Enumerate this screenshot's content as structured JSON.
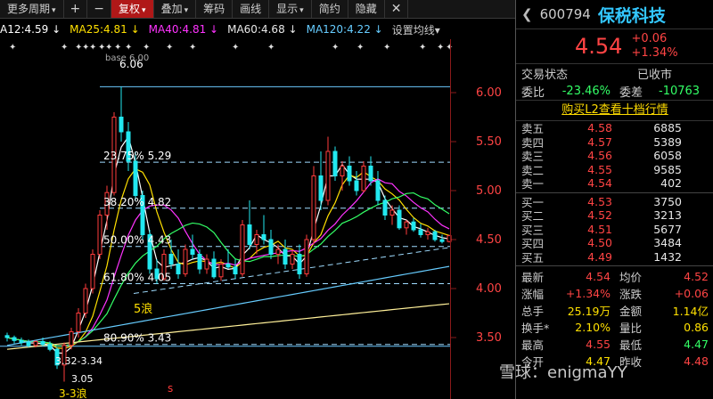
{
  "toolbar": {
    "period": "更多周期",
    "plus": "+",
    "minus": "−",
    "items": [
      "复权",
      "叠加",
      "筹码",
      "画线",
      "显示",
      "简约",
      "隐藏"
    ]
  },
  "ma": {
    "ma12": "A12:4.59",
    "ma25": "MA25:4.81",
    "ma40": "MA40:4.81",
    "ma60": "MA60:4.68",
    "ma120": "MA120:4.22",
    "settings": "设置均线"
  },
  "colors": {
    "up": "#ff3b3b",
    "down": "#22e8f0",
    "ma12": "#ffffff",
    "ma25": "#ffe000",
    "ma40": "#ff33ff",
    "ma60": "#33ff66",
    "ma120": "#66ccff",
    "ma250": "#fff099"
  },
  "chart": {
    "price_labels": [
      "6.00",
      "5.50",
      "5.00",
      "4.50",
      "4.00",
      "3.50"
    ],
    "top_label": "6.06",
    "top_partial": "base 6.00",
    "fib": [
      {
        "label": "23.75% 5.29",
        "price": 5.29
      },
      {
        "label": "38.20% 4.82",
        "price": 4.82
      },
      {
        "label": "50.00% 4.43",
        "price": 4.43
      },
      {
        "label": "61.80% 4.05",
        "price": 4.05
      },
      {
        "label": "80.90% 3.43",
        "price": 3.43
      }
    ],
    "top_line": 6.06,
    "bottom_line": 3.43,
    "low_range": "3.32-3.34",
    "low_label": "3.05",
    "wave_label": "5浪",
    "bottom_note": "3-3浪",
    "marker_s": "s"
  },
  "panel": {
    "code": "600794",
    "name": "保税科技",
    "price": "4.54",
    "change": "+0.06",
    "change_pct": "+1.34%",
    "trade_state_label": "交易状态",
    "trade_state": "已收市",
    "weibi_label": "委比",
    "weibi": "-23.46%",
    "weicha_label": "委差",
    "weicha": "-10763",
    "l2_link": "购买L2查看十档行情",
    "asks": [
      {
        "label": "卖五",
        "price": "4.58",
        "vol": "6885"
      },
      {
        "label": "卖四",
        "price": "4.57",
        "vol": "5389"
      },
      {
        "label": "卖三",
        "price": "4.56",
        "vol": "6058"
      },
      {
        "label": "卖二",
        "price": "4.55",
        "vol": "9585"
      },
      {
        "label": "卖一",
        "price": "4.54",
        "vol": "402"
      }
    ],
    "bids": [
      {
        "label": "买一",
        "price": "4.53",
        "vol": "3750"
      },
      {
        "label": "买二",
        "price": "4.52",
        "vol": "3213"
      },
      {
        "label": "买三",
        "price": "4.51",
        "vol": "5677"
      },
      {
        "label": "买四",
        "price": "4.50",
        "vol": "3484"
      },
      {
        "label": "买五",
        "price": "4.49",
        "vol": "1432"
      }
    ],
    "stats": [
      {
        "l1": "最新",
        "v1": "4.54",
        "l2": "均价",
        "v2": "4.52"
      },
      {
        "l1": "涨幅",
        "v1": "+1.34%",
        "l2": "涨跌",
        "v2": "+0.06"
      },
      {
        "l1": "总手",
        "v1": "25.19万",
        "l2": "金额",
        "v2": "1.14亿"
      },
      {
        "l1": "换手*",
        "v1": "2.10%",
        "l2": "量比",
        "v2": "0.86"
      },
      {
        "l1": "最高",
        "v1": "4.55",
        "l2": "最低",
        "v2": "4.47"
      },
      {
        "l1": "今开",
        "v1": "4.47",
        "l2": "昨收",
        "v2": "4.48"
      }
    ]
  },
  "watermark": "雪球：enigmaYY"
}
